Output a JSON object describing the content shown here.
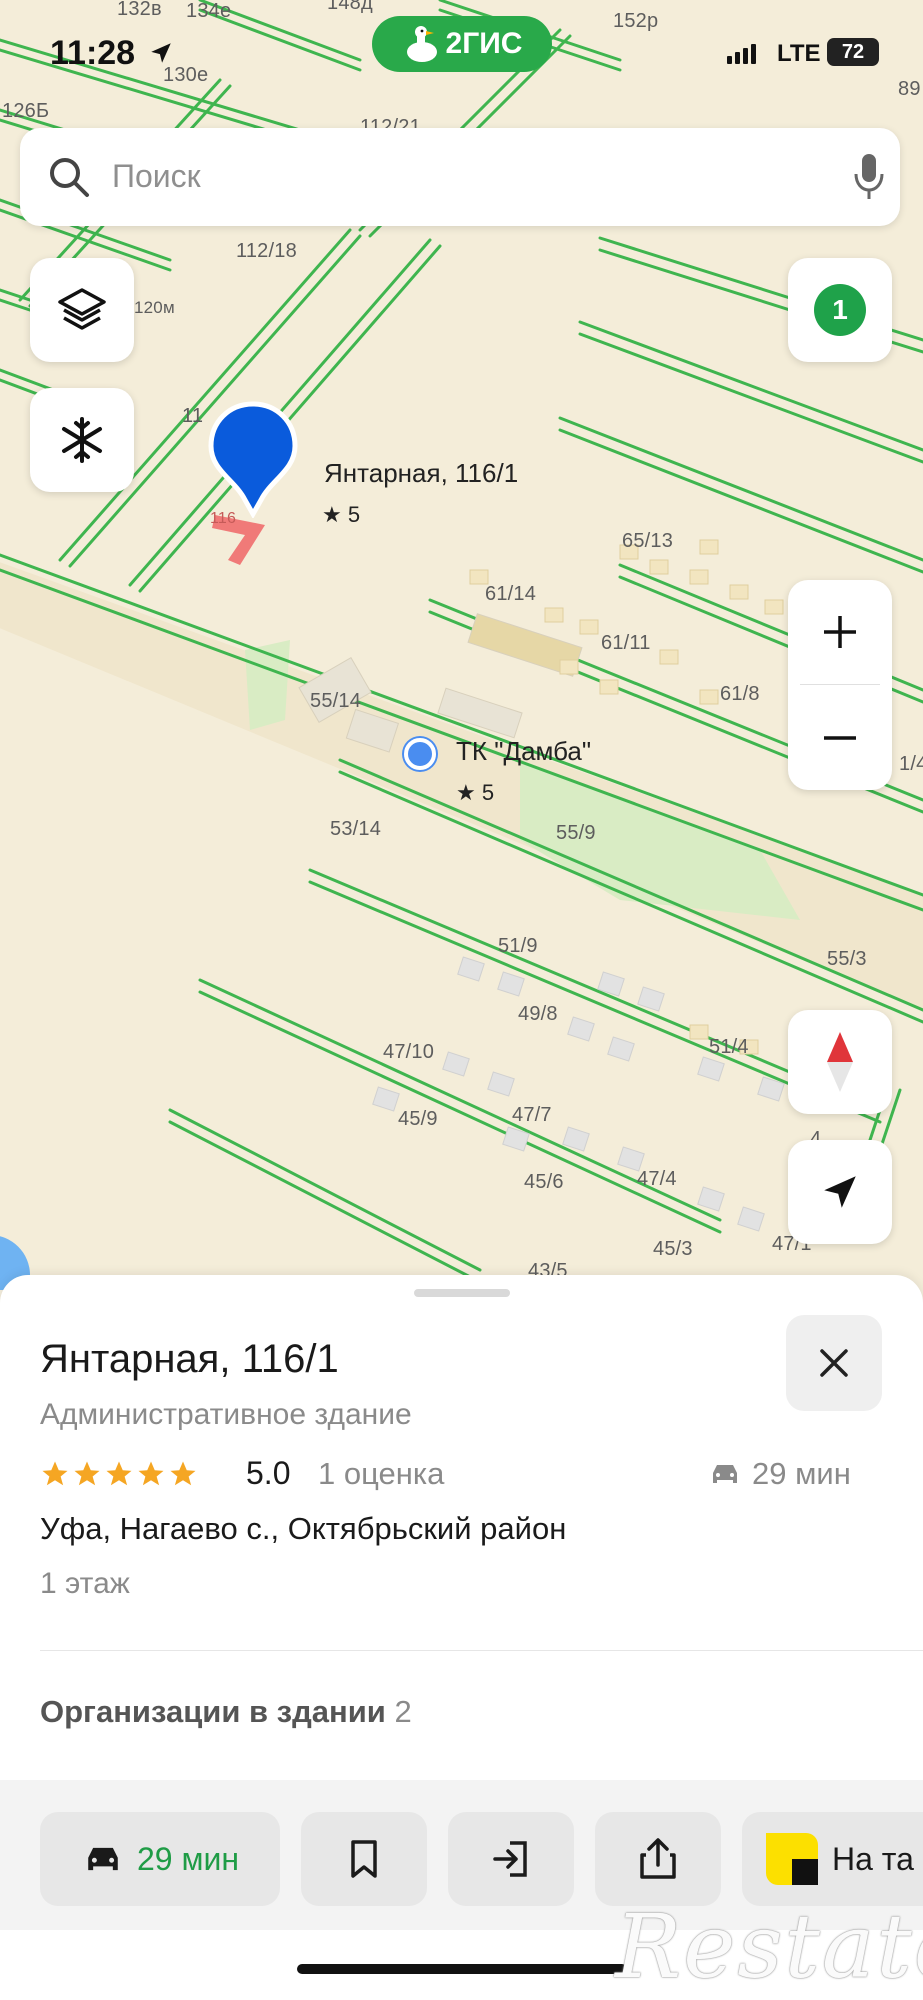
{
  "status_bar": {
    "time": "11:28",
    "network": "LTE",
    "battery": "72"
  },
  "brand": {
    "name": "2ГИС"
  },
  "search": {
    "placeholder": "Поиск"
  },
  "map": {
    "counter_badge": "1",
    "labels": [
      "132в",
      "134е",
      "148д",
      "130е",
      "152р",
      "126Б",
      "112/21",
      "112/18",
      "120м",
      "89",
      "65/13",
      "61/14",
      "61/11",
      "61/8",
      "55/14",
      "53/14",
      "55/9",
      "51/9",
      "55/3",
      "49/8",
      "51/4",
      "47/10",
      "47/7",
      "45/9",
      "45/6",
      "47/4",
      "45/3",
      "47/1",
      "43/5",
      "4",
      "1/4",
      "11",
      "116"
    ],
    "selected_pin": {
      "title": "Янтарная, 116/1",
      "rating": "★ 5"
    },
    "poi": {
      "title": "ТК \"Дамба\"",
      "rating": "★ 5"
    }
  },
  "sheet": {
    "title": "Янтарная, 116/1",
    "subtitle": "Административное здание",
    "stars_count": 5,
    "rating": "5.0",
    "ratings_count": "1 оценка",
    "route_time": "29 мин",
    "address": "Уфа, Нагаево с., Октябрьский район",
    "floor": "1 этаж",
    "orgs_label": "Организации в здании",
    "orgs_count": "2"
  },
  "actions": {
    "route_label": "29 мин",
    "taxi_label": "На та"
  },
  "watermark": "Restate",
  "colors": {
    "accent_green": "#1f9c46",
    "pin_blue": "#0a5bdc",
    "road_green": "#3fb54f",
    "star": "#f5a623"
  }
}
